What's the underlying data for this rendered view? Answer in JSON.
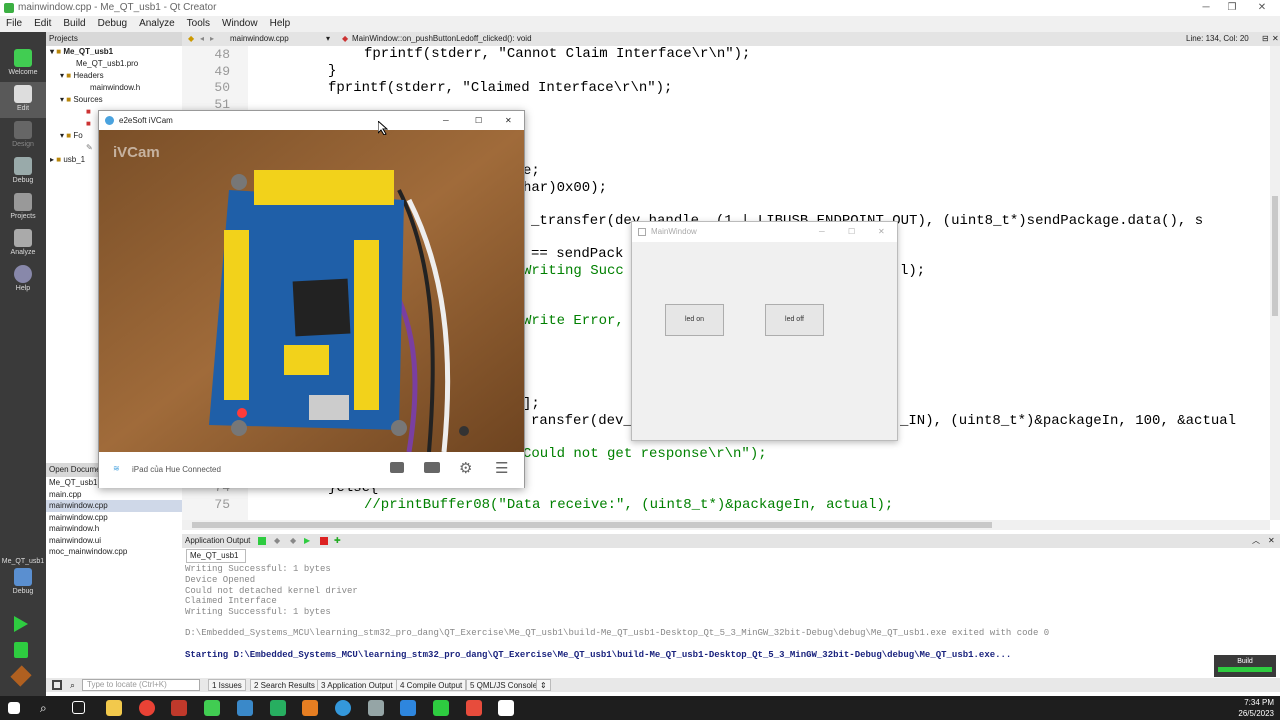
{
  "window": {
    "title": "mainwindow.cpp - Me_QT_usb1 - Qt Creator"
  },
  "menu": [
    "File",
    "Edit",
    "Build",
    "Debug",
    "Analyze",
    "Tools",
    "Window",
    "Help"
  ],
  "modes": [
    "Welcome",
    "Edit",
    "Design",
    "Debug",
    "Projects",
    "Analyze",
    "Help"
  ],
  "kit": {
    "project": "Me_QT_usb1",
    "mode": "Debug"
  },
  "projects": {
    "header": "Projects",
    "tree": [
      "Me_QT_usb1",
      "Me_QT_usb1.pro",
      "Headers",
      "mainwindow.h",
      "Sources",
      "Fo",
      "usb_1"
    ]
  },
  "open_documents": {
    "header": "Open Documents",
    "items": [
      "Me_QT_usb1.pro",
      "main.cpp",
      "mainwindow.cpp",
      "mainwindow.cpp",
      "mainwindow.h",
      "mainwindow.ui",
      "moc_mainwindow.cpp"
    ],
    "selected": 2
  },
  "editor": {
    "file": "mainwindow.cpp",
    "function": "MainWindow::on_pushButtonLedoff_clicked(): void",
    "position": "Line: 134, Col: 20"
  },
  "code": {
    "line_numbers": [
      "48",
      "49",
      "50",
      "51",
      "74",
      "75"
    ],
    "lines": [
      {
        "indent": "    ",
        "text": "fprintf(stderr, \"Cannot Claim Interface\\r\\n\");"
      },
      {
        "indent": "",
        "text": "}"
      },
      {
        "indent": "",
        "text": "fprintf(stderr, \"Claimed Interface\\r\\n\");"
      },
      {
        "indent": "",
        "text": "e;"
      },
      {
        "indent": "",
        "text": "har)0x00);"
      },
      {
        "indent": "",
        "text": "_transfer(dev_handle, (1 | LIBUSB_ENDPOINT_OUT), (uint8_t*)sendPackage.data(), s"
      },
      {
        "indent": "",
        "text": "== sendPack"
      },
      {
        "indent": "",
        "text": "Writing Succ"
      },
      {
        "indent": "",
        "text": "l);"
      },
      {
        "indent": "",
        "text": "Write Error,"
      },
      {
        "indent": "",
        "text": "];"
      },
      {
        "indent": "",
        "text": "ransfer(dev_"
      },
      {
        "indent": "",
        "text": "_IN), (uint8_t*)&packageIn, 100, &actual"
      },
      {
        "indent": "",
        "text": "Could not get response\\r\\n\");"
      },
      {
        "indent": "",
        "text": "}else{"
      },
      {
        "indent": "    ",
        "text": "//printBuffer08(\"Data receive:\", (uint8_t*)&packageIn, actual);"
      }
    ]
  },
  "ivcam": {
    "title": "e2eSoft iVCam",
    "watermark": "iVCam",
    "status": "iPad của Hue Connected"
  },
  "mainwindow": {
    "title": "MainWindow",
    "led_on": "led on",
    "led_off": "led off"
  },
  "output": {
    "header": "Application Output",
    "tab": "Me_QT_usb1",
    "lines": [
      "Writing Successful: 1 bytes",
      "Device Opened",
      "Could not detached kernel driver",
      "Claimed Interface",
      "Writing Successful: 1 bytes",
      "",
      "D:\\Embedded_Systems_MCU\\learning_stm32_pro_dang\\QT_Exercise\\Me_QT_usb1\\build-Me_QT_usb1-Desktop_Qt_5_3_MinGW_32bit-Debug\\debug\\Me_QT_usb1.exe exited with code 0"
    ],
    "start_line": "Starting D:\\Embedded_Systems_MCU\\learning_stm32_pro_dang\\QT_Exercise\\Me_QT_usb1\\build-Me_QT_usb1-Desktop_Qt_5_3_MinGW_32bit-Debug\\debug\\Me_QT_usb1.exe..."
  },
  "build_button": "Build",
  "statusbar": {
    "locate_placeholder": "Type to locate (Ctrl+K)",
    "panes": [
      "1 Issues",
      "2 Search Results",
      "3 Application Output",
      "4 Compile Output",
      "5 QML/JS Console"
    ]
  },
  "clock": {
    "time": "7:34 PM",
    "date": "26/5/2023"
  }
}
